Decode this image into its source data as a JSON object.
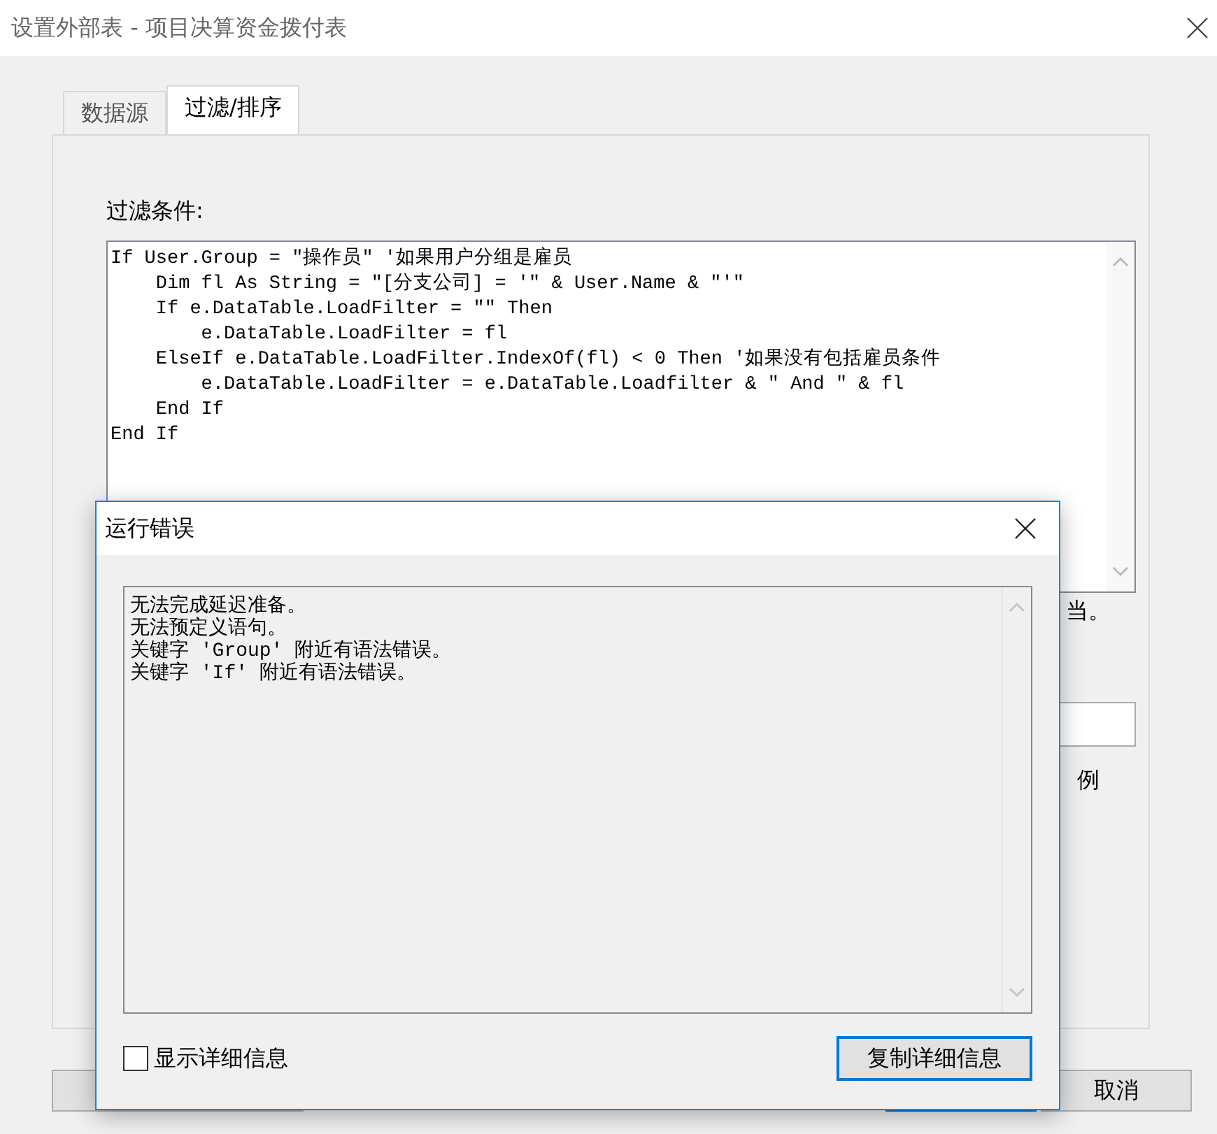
{
  "window": {
    "title": "设置外部表 - 项目决算资金拨付表"
  },
  "tabs": [
    {
      "label": "数据源",
      "selected": false
    },
    {
      "label": "过滤/排序",
      "selected": true
    }
  ],
  "filter": {
    "label": "过滤条件:",
    "code_lines": [
      "If User.Group = \"操作员\" '如果用户分组是雇员",
      "    Dim fl As String = \"[分支公司] = '\" & User.Name & \"'\"",
      "    If e.DataTable.LoadFilter = \"\" Then",
      "        e.DataTable.LoadFilter = fl",
      "    ElseIf e.DataTable.LoadFilter.IndexOf(fl) < 0 Then '如果没有包括雇员条件",
      "        e.DataTable.LoadFilter = e.DataTable.Loadfilter & \" And \" & fl",
      "    End If",
      "End If"
    ]
  },
  "partly_hidden_text": "当。",
  "side_label": "例",
  "cancel_button": "取消",
  "error_dialog": {
    "title": "运行错误",
    "messages": [
      "无法完成延迟准备。",
      "无法预定义语句。",
      "关键字 'Group' 附近有语法错误。",
      "关键字 'If' 附近有语法错误。"
    ],
    "show_details": {
      "label": "显示详细信息",
      "checked": false
    },
    "copy_button": "复制详细信息"
  }
}
